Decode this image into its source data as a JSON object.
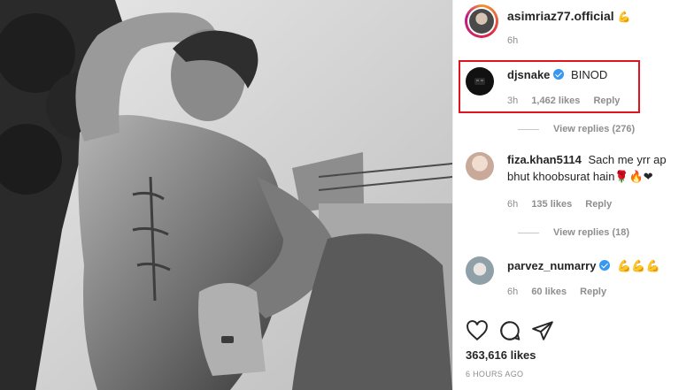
{
  "post": {
    "author": "asimriaz77.official",
    "author_emoji": "💪",
    "time": "6h"
  },
  "comments": [
    {
      "username": "djsnake",
      "verified": true,
      "text": "BINOD",
      "time": "3h",
      "likes": "1,462 likes",
      "reply": "Reply",
      "view_replies": "View replies (276)"
    },
    {
      "username": "fiza.khan5114",
      "verified": false,
      "text": "Sach me yrr ap bhut khoobsurat hain🌹🔥❤",
      "time": "6h",
      "likes": "135 likes",
      "reply": "Reply",
      "view_replies": "View replies (18)"
    },
    {
      "username": "parvez_numarry",
      "verified": true,
      "text": "💪💪💪",
      "time": "6h",
      "likes": "60 likes",
      "reply": "Reply"
    }
  ],
  "footer": {
    "likes": "363,616 likes",
    "timestamp": "6 HOURS AGO"
  },
  "icons": {
    "like": "heart-icon",
    "comment": "comment-icon",
    "share": "share-icon"
  },
  "colors": {
    "highlight": "#e0141e",
    "verified": "#3897f0",
    "meta_text": "#8e8e8e"
  }
}
